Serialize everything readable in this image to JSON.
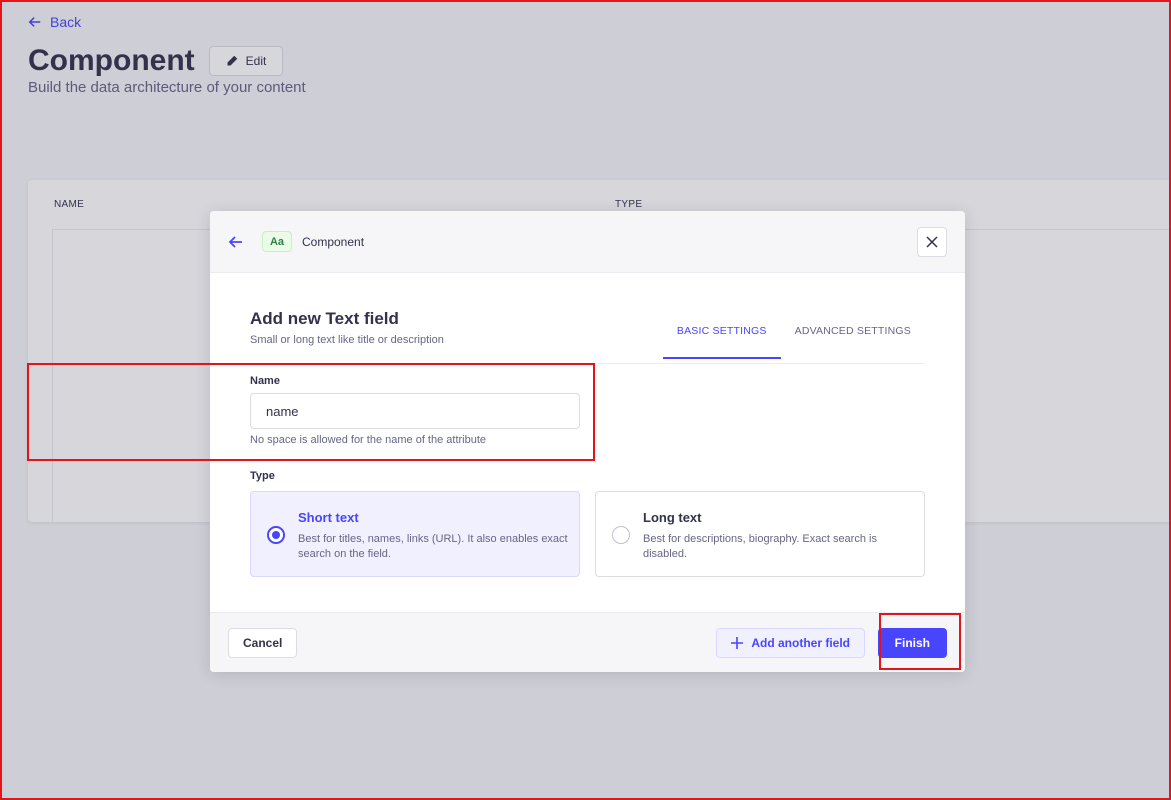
{
  "page": {
    "back_label": "Back",
    "title": "Component",
    "edit_label": "Edit",
    "subtitle": "Build the data architecture of your content",
    "table": {
      "col_name": "NAME",
      "col_type": "TYPE"
    }
  },
  "modal": {
    "header": {
      "badge": "Aa",
      "title": "Component"
    },
    "form_title": "Add new Text field",
    "form_subtitle": "Small or long text like title or description",
    "tabs": [
      {
        "label": "BASIC SETTINGS",
        "active": true
      },
      {
        "label": "ADVANCED SETTINGS",
        "active": false
      }
    ],
    "name_field": {
      "label": "Name",
      "value": "name",
      "hint": "No space is allowed for the name of the attribute"
    },
    "type_field": {
      "label": "Type",
      "options": [
        {
          "title": "Short text",
          "description": "Best for titles, names, links (URL). It also enables exact search on the field.",
          "selected": true
        },
        {
          "title": "Long text",
          "description": "Best for descriptions, biography. Exact search is disabled.",
          "selected": false
        }
      ]
    },
    "footer": {
      "cancel_label": "Cancel",
      "add_field_label": "Add another field",
      "finish_label": "Finish"
    }
  },
  "colors": {
    "accent": "#4945ff",
    "highlight": "#e0161b"
  }
}
